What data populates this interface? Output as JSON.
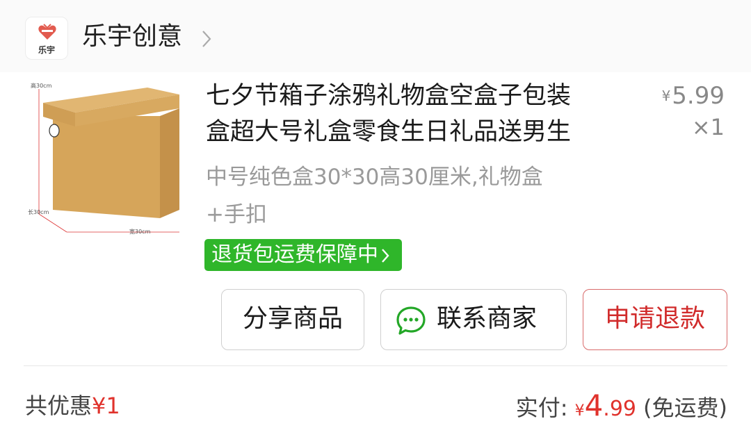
{
  "shop": {
    "logo_text": "乐宇",
    "name": "乐宇创意",
    "icon": "chevron-right-icon"
  },
  "product": {
    "image_labels": {
      "height": "高30cm",
      "length": "长30cm",
      "width": "宽30cm"
    },
    "title_lines": [
      "七夕节箱子涂鸦礼物盒空盒子包装",
      "盒超大号礼盒零食生日礼品送男生"
    ],
    "price_symbol": "¥",
    "price": "5.99",
    "quantity": "×1",
    "sku_lines": [
      "中号纯色盒30*30高30厘米,礼物盒",
      "+手扣"
    ],
    "guarantee_label": "退货包运费保障中"
  },
  "actions": {
    "share_label": "分享商品",
    "contact_label": "联系商家",
    "refund_label": "申请退款"
  },
  "summary": {
    "discount_label": "共优惠",
    "discount_amount": "¥1",
    "paid_label": "实付:",
    "paid_symbol": "¥",
    "paid_int": "4",
    "paid_dec": ".99",
    "shipping_note": "(免运费)"
  },
  "colors": {
    "guarantee_green": "#2fb62a",
    "refund_red": "#d12b2b",
    "price_red": "#e0322c"
  }
}
